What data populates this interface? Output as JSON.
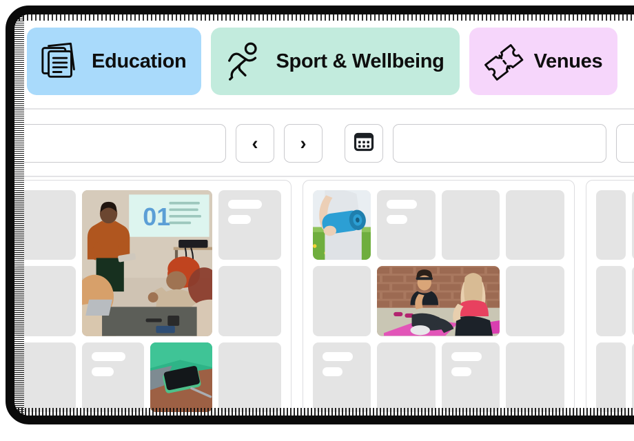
{
  "categories": [
    {
      "label": "Education",
      "icon": "documents-stack-icon",
      "bg": "#A9DAFB"
    },
    {
      "label": "Sport & Wellbeing",
      "icon": "running-person-icon",
      "bg": "#C2EBDD"
    },
    {
      "label": "Venues",
      "icon": "ticket-icon",
      "bg": "#F6D6FB"
    }
  ],
  "toolbar": {
    "search_value": "",
    "search_placeholder": "",
    "prev_label": "‹",
    "next_label": "›",
    "calendar_icon": "calendar-icon",
    "date_value": "",
    "date_placeholder": "",
    "trailing_value": ""
  },
  "panels": [
    {
      "name": "education-panel",
      "tiles": [
        {
          "type": "skeleton"
        },
        {
          "type": "image",
          "subject": "presenter-giving-talk-to-audience",
          "span": 2,
          "rows": 2
        },
        {
          "type": "skeleton",
          "lines": 2
        },
        {
          "type": "skeleton"
        },
        {
          "type": "skeleton"
        },
        {
          "type": "skeleton"
        },
        {
          "type": "skeleton",
          "lines": 2
        },
        {
          "type": "image",
          "subject": "green-phone-and-pen-on-desk",
          "span": 1
        },
        {
          "type": "skeleton"
        }
      ]
    },
    {
      "name": "sport-panel",
      "tiles": [
        {
          "type": "image",
          "subject": "woman-holding-blue-yoga-mat",
          "span": 1
        },
        {
          "type": "skeleton",
          "lines": 2
        },
        {
          "type": "skeleton"
        },
        {
          "type": "skeleton"
        },
        {
          "type": "skeleton"
        },
        {
          "type": "image",
          "subject": "two-women-exercising-in-studio",
          "span": 2
        },
        {
          "type": "skeleton"
        },
        {
          "type": "skeleton",
          "lines": 2
        },
        {
          "type": "skeleton"
        },
        {
          "type": "skeleton",
          "lines": 2
        },
        {
          "type": "skeleton"
        }
      ]
    },
    {
      "name": "venues-panel",
      "tiles": [
        {
          "type": "skeleton"
        },
        {
          "type": "skeleton"
        },
        {
          "type": "skeleton"
        }
      ]
    }
  ]
}
